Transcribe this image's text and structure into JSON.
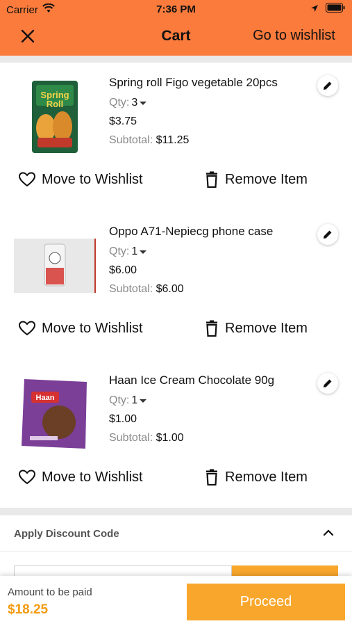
{
  "status": {
    "carrier": "Carrier",
    "time": "7:36 PM"
  },
  "header": {
    "title": "Cart",
    "wishlist_link": "Go to wishlist"
  },
  "colors": {
    "header_bg": "#fb7b3c",
    "accent": "#f8a72c",
    "amount": "#f39c12"
  },
  "labels": {
    "qty": "Qty:",
    "subtotal": "Subtotal:",
    "move_to_wishlist": "Move to Wishlist",
    "remove_item": "Remove Item"
  },
  "items": [
    {
      "name": "Spring roll Figo vegetable 20pcs",
      "qty": "3",
      "price": "$3.75",
      "subtotal": "$11.25",
      "image": "spring-roll-package-image"
    },
    {
      "name": "Oppo A71-Nepiecg phone case",
      "qty": "1",
      "price": "$6.00",
      "subtotal": "$6.00",
      "image": "phone-case-image"
    },
    {
      "name": "Haan Ice Cream Chocolate 90g",
      "qty": "1",
      "price": "$1.00",
      "subtotal": "$1.00",
      "image": "ice-cream-package-image"
    }
  ],
  "discount": {
    "label": "Apply Discount Code"
  },
  "footer": {
    "amount_label": "Amount to be paid",
    "amount": "$18.25",
    "proceed_label": "Proceed"
  },
  "icons": [
    "wifi-icon",
    "location-arrow-icon",
    "battery-icon",
    "close-icon",
    "edit-pencil-icon",
    "heart-icon",
    "trash-icon",
    "chevron-up-icon"
  ]
}
